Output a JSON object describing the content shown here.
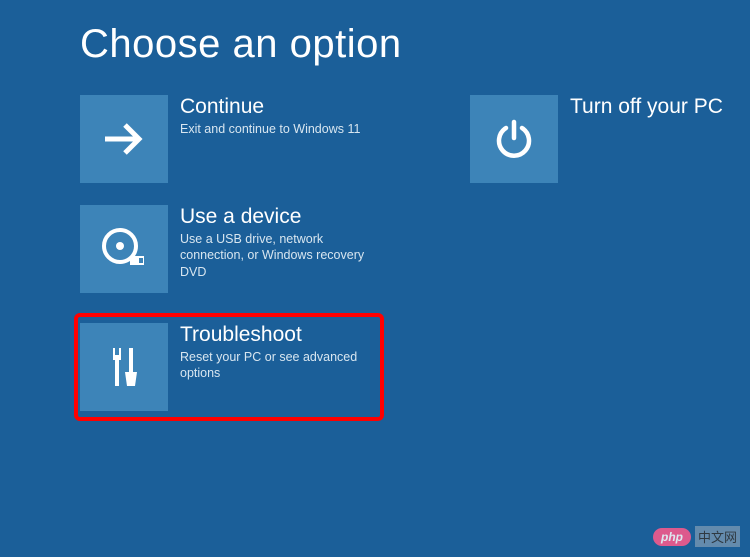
{
  "page": {
    "title": "Choose an option"
  },
  "options": {
    "continue": {
      "title": "Continue",
      "desc": "Exit and continue to Windows 11"
    },
    "useDevice": {
      "title": "Use a device",
      "desc": "Use a USB drive, network connection, or Windows recovery DVD"
    },
    "troubleshoot": {
      "title": "Troubleshoot",
      "desc": "Reset your PC or see advanced options"
    },
    "turnOff": {
      "title": "Turn off your PC",
      "desc": ""
    }
  },
  "watermark": {
    "badge": "php",
    "label": "中文网"
  },
  "colors": {
    "background": "#1b5f99",
    "tile": "#3d84b8",
    "highlight": "#ff0000"
  }
}
